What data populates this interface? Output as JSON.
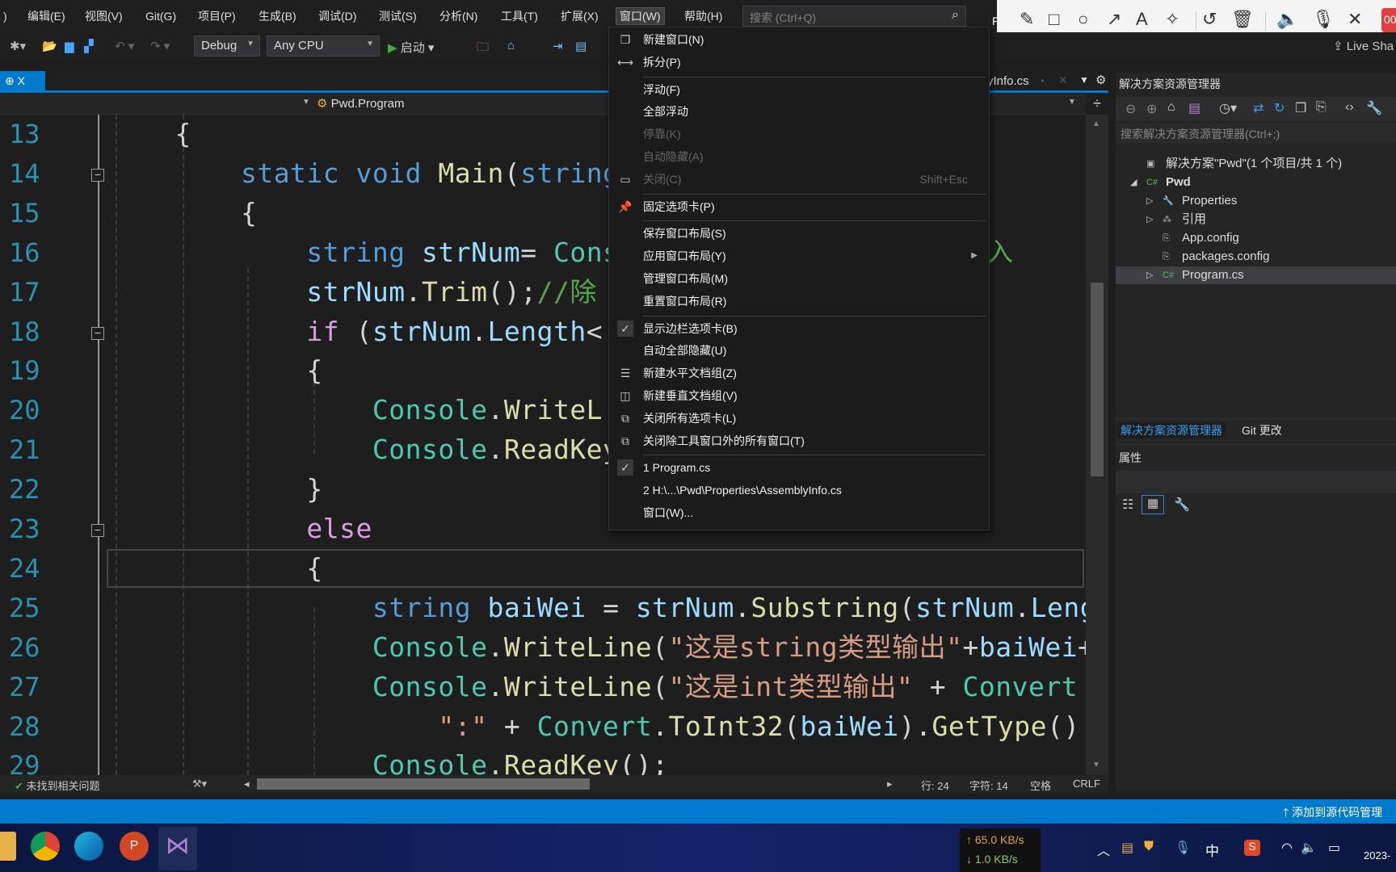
{
  "menubar": {
    "items": [
      ")",
      "编辑(E)",
      "视图(V)",
      "Git(G)",
      "项目(P)",
      "生成(B)",
      "调试(D)",
      "测试(S)",
      "分析(N)",
      "工具(T)",
      "扩展(X)",
      "窗口(W)",
      "帮助(H)"
    ],
    "active": "窗口(W)",
    "search_placeholder": "搜索 (Ctrl+Q)",
    "search_icon": "search-icon"
  },
  "annotation_toolbar": {
    "tools": [
      "pencil",
      "rectangle",
      "circle",
      "arrow",
      "text",
      "magic-wand",
      "undo",
      "delete",
      "speaker",
      "microphone",
      "close"
    ],
    "partial_label": "F",
    "record_label": "00"
  },
  "toolbar": {
    "config": "Debug",
    "platform": "Any CPU",
    "start_label": "启动",
    "live_share": "Live Sha"
  },
  "tabs": {
    "active_pin": "⊕",
    "active_close": "X",
    "right_tab": "yInfo.cs"
  },
  "navbar": {
    "member": "Pwd.Program"
  },
  "editor": {
    "lines": [
      {
        "n": "13",
        "tokens": [
          [
            "    ",
            "p"
          ],
          [
            "{",
            "p"
          ]
        ]
      },
      {
        "n": "14",
        "tokens": [
          [
            "        ",
            "p"
          ],
          [
            "static",
            "k"
          ],
          [
            " ",
            "p"
          ],
          [
            "void",
            "k"
          ],
          [
            " ",
            "p"
          ],
          [
            "Main",
            "m"
          ],
          [
            "(",
            "p"
          ],
          [
            "string",
            "k"
          ]
        ]
      },
      {
        "n": "15",
        "tokens": [
          [
            "        ",
            "p"
          ],
          [
            "{",
            "p"
          ]
        ]
      },
      {
        "n": "16",
        "tokens": [
          [
            "            ",
            "p"
          ],
          [
            "string",
            "k"
          ],
          [
            " ",
            "p"
          ],
          [
            "strNum",
            "v"
          ],
          [
            "= ",
            "p"
          ],
          [
            "Cons",
            "t"
          ]
        ]
      },
      {
        "n": "17",
        "tokens": [
          [
            "            ",
            "p"
          ],
          [
            "strNum",
            "v"
          ],
          [
            ".",
            "p"
          ],
          [
            "Trim",
            "m"
          ],
          [
            "();",
            "p"
          ],
          [
            "//除",
            "c"
          ]
        ]
      },
      {
        "n": "18",
        "tokens": [
          [
            "            ",
            "p"
          ],
          [
            "if",
            "f"
          ],
          [
            " (",
            "p"
          ],
          [
            "strNum",
            "v"
          ],
          [
            ".",
            "p"
          ],
          [
            "Length",
            "v"
          ],
          [
            "<",
            "p"
          ]
        ]
      },
      {
        "n": "19",
        "tokens": [
          [
            "            ",
            "p"
          ],
          [
            "{",
            "p"
          ]
        ]
      },
      {
        "n": "20",
        "tokens": [
          [
            "                ",
            "p"
          ],
          [
            "Console",
            "t"
          ],
          [
            ".",
            "p"
          ],
          [
            "WriteL",
            "m"
          ]
        ]
      },
      {
        "n": "21",
        "tokens": [
          [
            "                ",
            "p"
          ],
          [
            "Console",
            "t"
          ],
          [
            ".",
            "p"
          ],
          [
            "ReadKey",
            "m"
          ]
        ]
      },
      {
        "n": "22",
        "tokens": [
          [
            "            ",
            "p"
          ],
          [
            "}",
            "p"
          ]
        ]
      },
      {
        "n": "23",
        "tokens": [
          [
            "            ",
            "p"
          ],
          [
            "else",
            "f"
          ]
        ]
      },
      {
        "n": "24",
        "tokens": [
          [
            "            ",
            "p"
          ],
          [
            "{",
            "p"
          ]
        ]
      },
      {
        "n": "25",
        "tokens": [
          [
            "                ",
            "p"
          ],
          [
            "string",
            "k"
          ],
          [
            " ",
            "p"
          ],
          [
            "baiWei",
            "v"
          ],
          [
            " = ",
            "p"
          ],
          [
            "strNum",
            "v"
          ],
          [
            ".",
            "p"
          ],
          [
            "Substring",
            "m"
          ],
          [
            "(",
            "p"
          ],
          [
            "strNum",
            "v"
          ],
          [
            ".",
            "p"
          ],
          [
            "Leng",
            "v"
          ]
        ]
      },
      {
        "n": "26",
        "tokens": [
          [
            "                ",
            "p"
          ],
          [
            "Console",
            "t"
          ],
          [
            ".",
            "p"
          ],
          [
            "WriteLine",
            "m"
          ],
          [
            "(",
            "p"
          ],
          [
            "\"这是string类型输出\"",
            "s"
          ],
          [
            "+",
            "p"
          ],
          [
            "baiWei",
            "v"
          ],
          [
            "+",
            "p"
          ]
        ]
      },
      {
        "n": "27",
        "tokens": [
          [
            "                ",
            "p"
          ],
          [
            "Console",
            "t"
          ],
          [
            ".",
            "p"
          ],
          [
            "WriteLine",
            "m"
          ],
          [
            "(",
            "p"
          ],
          [
            "\"这是int类型输出\"",
            "s"
          ],
          [
            " + ",
            "p"
          ],
          [
            "Convert",
            "t"
          ]
        ]
      },
      {
        "n": "28",
        "tokens": [
          [
            "                    ",
            "p"
          ],
          [
            "\":\"",
            "s"
          ],
          [
            " + ",
            "p"
          ],
          [
            "Convert",
            "t"
          ],
          [
            ".",
            "p"
          ],
          [
            "ToInt32",
            "m"
          ],
          [
            "(",
            "p"
          ],
          [
            "baiWei",
            "v"
          ],
          [
            ").",
            "p"
          ],
          [
            "GetType",
            "m"
          ],
          [
            "()",
            "p"
          ]
        ]
      },
      {
        "n": "29",
        "tokens": [
          [
            "                ",
            "p"
          ],
          [
            "Console",
            "t"
          ],
          [
            ".",
            "p"
          ],
          [
            "ReadKey",
            "m"
          ],
          [
            "();",
            "p"
          ]
        ]
      }
    ],
    "line16_tail": "入",
    "current_line": "24"
  },
  "editor_status": {
    "issues": "未找到相关问题",
    "row": "行: 24",
    "col": "字符: 14",
    "spaces": "空格",
    "eol": "CRLF"
  },
  "window_menu": {
    "items": [
      {
        "label": "新建窗口(N)",
        "icon": "new-window-icon",
        "glyph": "❐"
      },
      {
        "label": "拆分(P)",
        "icon": "split-icon",
        "glyph": "⟷"
      },
      {
        "sep": true
      },
      {
        "label": "浮动(F)"
      },
      {
        "label": "全部浮动"
      },
      {
        "label": "停靠(K)",
        "disabled": true
      },
      {
        "label": "自动隐藏(A)",
        "disabled": true
      },
      {
        "label": "关闭(C)",
        "disabled": true,
        "shortcut": "Shift+Esc",
        "icon": "close-window-icon",
        "glyph": "▭"
      },
      {
        "sep": true
      },
      {
        "label": "固定选项卡(P)",
        "icon": "pin-icon",
        "glyph": "📌"
      },
      {
        "sep": true
      },
      {
        "label": "保存窗口布局(S)"
      },
      {
        "label": "应用窗口布局(Y)",
        "submenu": true
      },
      {
        "label": "管理窗口布局(M)"
      },
      {
        "label": "重置窗口布局(R)"
      },
      {
        "sep": true
      },
      {
        "label": "显示边栏选项卡(B)",
        "checked": true,
        "icon": "check-icon",
        "glyph": "✓"
      },
      {
        "label": "自动全部隐藏(U)"
      },
      {
        "label": "新建水平文档组(Z)",
        "icon": "horizontal-group-icon",
        "glyph": "☰"
      },
      {
        "label": "新建垂直文档组(V)",
        "icon": "vertical-group-icon",
        "glyph": "◫"
      },
      {
        "label": "关闭所有选项卡(L)",
        "icon": "close-all-tabs-icon",
        "glyph": "⧉"
      },
      {
        "label": "关闭除工具窗口外的所有窗口(T)",
        "icon": "close-all-windows-icon",
        "glyph": "⧉"
      },
      {
        "sep": true
      },
      {
        "label": "1 Program.cs",
        "checked": true,
        "icon": "check-icon",
        "glyph": "✓"
      },
      {
        "label": "2 H:\\...\\Pwd\\Properties\\AssemblyInfo.cs"
      },
      {
        "label": "窗口(W)..."
      }
    ]
  },
  "solution_explorer": {
    "title": "解决方案资源管理器",
    "search_placeholder": "搜索解决方案资源管理器(Ctrl+;)",
    "tree": [
      {
        "label": "解决方案\"Pwd\"(1 个项目/共 1 个)",
        "icon": "solution-icon",
        "glyph": "▣",
        "expander": ""
      },
      {
        "label": "Pwd",
        "icon": "csharp-project-icon",
        "glyph": "C#",
        "expander": "◢",
        "bold": true
      },
      {
        "label": "Properties",
        "icon": "wrench-icon",
        "glyph": "🔧",
        "expander": "▷"
      },
      {
        "label": "引用",
        "icon": "references-icon",
        "glyph": "⁂",
        "expander": "▷"
      },
      {
        "label": "App.config",
        "icon": "config-file-icon",
        "glyph": "⎘",
        "expander": ""
      },
      {
        "label": "packages.config",
        "icon": "config-file-icon",
        "glyph": "⎘",
        "expander": ""
      },
      {
        "label": "Program.cs",
        "icon": "csharp-file-icon",
        "glyph": "C#",
        "expander": "▷",
        "selected": true
      }
    ],
    "tabs": [
      "解决方案资源管理器",
      "Git 更改"
    ],
    "active_tab": "解决方案资源管理器"
  },
  "properties": {
    "title": "属性"
  },
  "statusbar": {
    "source_control": "添加到源代码管理"
  },
  "taskbar": {
    "apps": [
      "file-explorer",
      "chrome",
      "edge",
      "powerpoint",
      "visual-studio"
    ],
    "upload": "↑ 65.0 KB/s",
    "download": "↓ 1.0 KB/s",
    "ime": "中",
    "clock": "2023-"
  },
  "colors": {
    "accent": "#007acc",
    "editor_bg": "#1e1e1e",
    "keyword": "#569cd6",
    "type": "#4ec9b0",
    "method": "#dcdcaa",
    "string": "#d69d85",
    "comment": "#57a64a"
  }
}
